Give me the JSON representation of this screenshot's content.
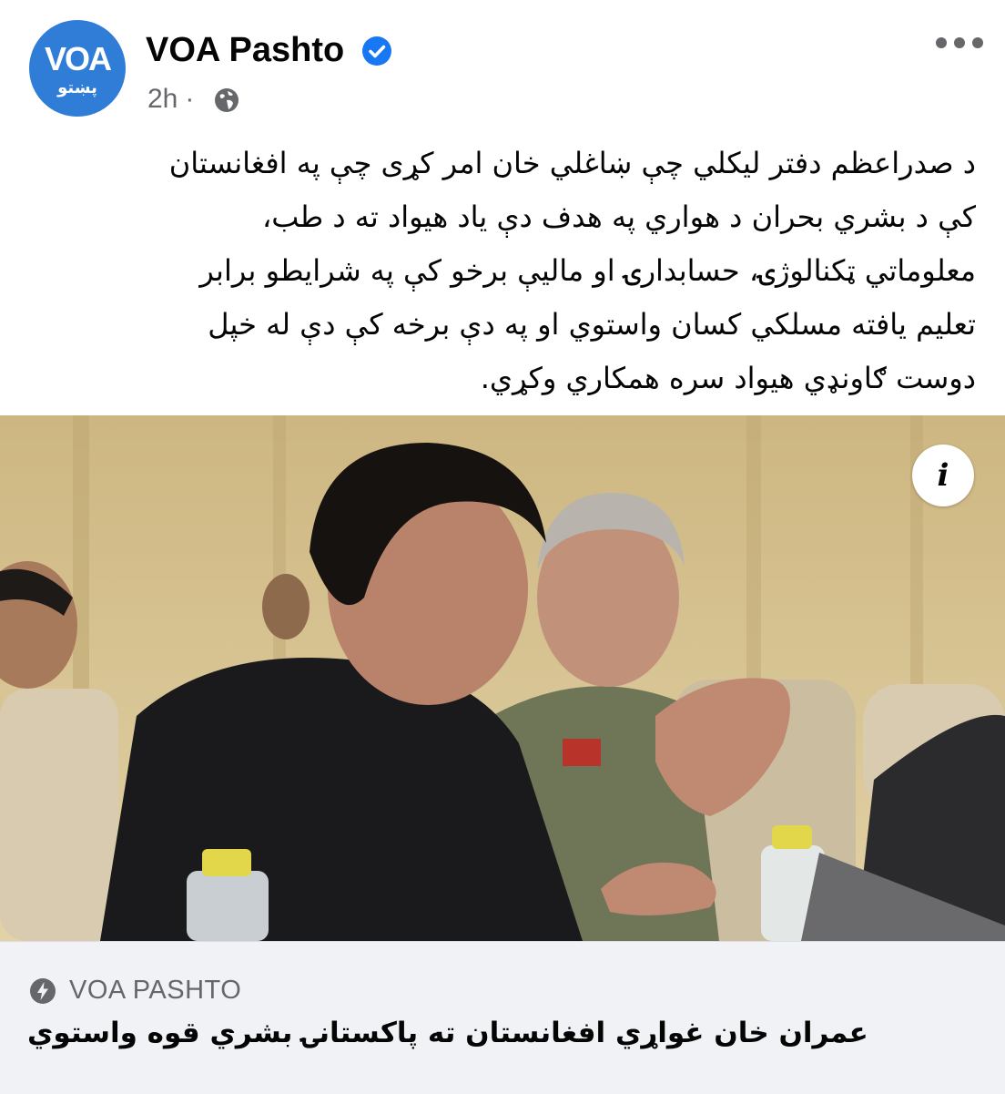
{
  "post": {
    "avatar_top": "VOA",
    "avatar_bottom": "پښتو",
    "page_name": "VOA Pashto",
    "time": "2h",
    "separator": "·",
    "body_lines": [
      "د صدراعظم دفتر لیکلي چې ښاغلي خان امر کړی چې په افغانستان",
      "کې د بشري بحران د هواري په هدف دې یاد هیواد ته د طب،",
      "معلوماتي ټکنالوژۍ، حسابدارۍ او مالیې برخو کې په شرایطو برابر",
      "تعلیم یافته مسلکي کسان واستوي او په دې برخه کې دې له خپل",
      "دوست ګاونډي هیواد سره همکاري وکړي."
    ],
    "info_glyph": "i"
  },
  "link_card": {
    "source": "VOA PASHTO",
    "headline": "عمران خان غواړي افغانستان ته پاکستانۍ بشري قوه واستوي"
  },
  "colors": {
    "brand_blue": "#1877f2",
    "avatar_blue": "#2f7dd6",
    "secondary_text": "#65676b",
    "card_bg": "#f0f2f5"
  }
}
